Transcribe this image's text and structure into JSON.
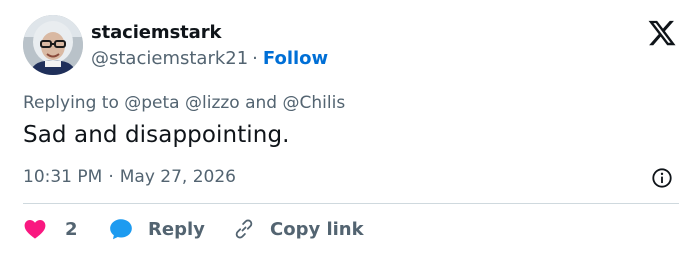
{
  "user": {
    "display_name": "staciemstark",
    "handle": "@staciemstark21",
    "separator": "·",
    "follow_label": "Follow"
  },
  "icons": {
    "logo": "x-logo-icon",
    "info": "info-icon",
    "like": "heart-icon",
    "reply": "speech-bubble-icon",
    "copy": "link-icon"
  },
  "colors": {
    "accent": "#006fd6",
    "like": "#f91880",
    "reply": "#1d9bf0",
    "muted": "#536471"
  },
  "reply_context": {
    "prefix": "Replying to",
    "mention_1": "@peta",
    "mention_2": "@lizzo",
    "conjunction": "and",
    "mention_3": "@Chilis"
  },
  "tweet": {
    "text": "Sad and disappointing.",
    "time": "10:31 PM",
    "separator": "·",
    "date": "May 27, 2026"
  },
  "actions": {
    "like_count": "2",
    "reply_label": "Reply",
    "copy_label": "Copy link"
  }
}
